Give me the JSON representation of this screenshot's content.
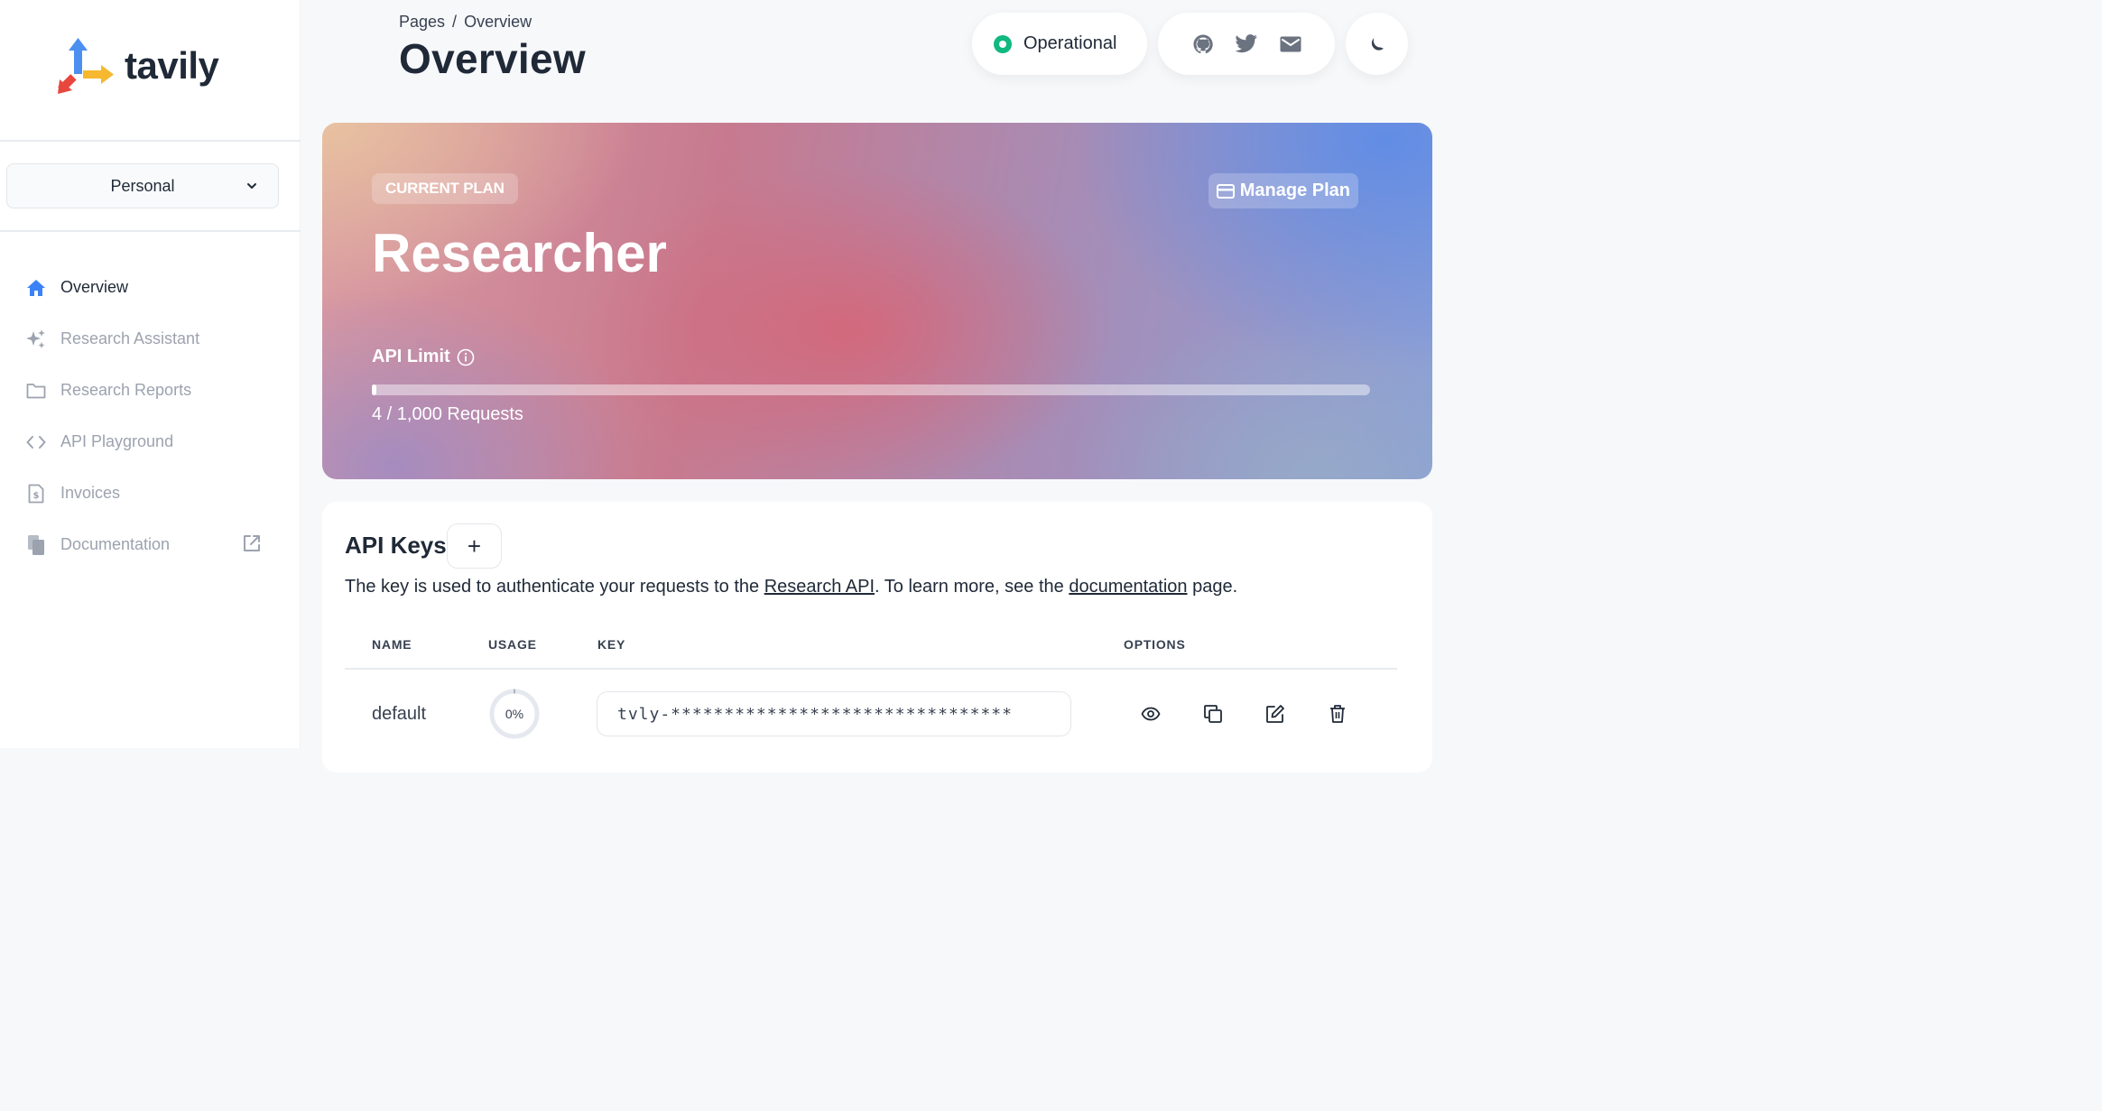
{
  "brand": {
    "name": "tavily"
  },
  "sidebar": {
    "workspace": {
      "selected": "Personal"
    },
    "items": [
      {
        "label": "Overview",
        "icon": "home-icon",
        "active": true
      },
      {
        "label": "Research Assistant",
        "icon": "sparkles-icon",
        "active": false
      },
      {
        "label": "Research Reports",
        "icon": "folder-icon",
        "active": false
      },
      {
        "label": "API Playground",
        "icon": "code-icon",
        "active": false
      },
      {
        "label": "Invoices",
        "icon": "invoice-icon",
        "active": false
      },
      {
        "label": "Documentation",
        "icon": "documents-icon",
        "active": false,
        "external": true
      }
    ]
  },
  "header": {
    "breadcrumb": {
      "parent": "Pages",
      "separator": "/",
      "current": "Overview"
    },
    "title": "Overview",
    "status": {
      "label": "Operational",
      "color": "#10b981"
    },
    "social": [
      "github-icon",
      "twitter-icon",
      "mail-icon"
    ],
    "theme_toggle": "moon-icon"
  },
  "plan": {
    "badge": "CURRENT PLAN",
    "name": "Researcher",
    "manage_label": "Manage Plan",
    "limit_label": "API Limit",
    "used": 4,
    "limit": 1000,
    "usage_text": "4 / 1,000 Requests"
  },
  "api_keys": {
    "title": "API Keys",
    "add_label": "+",
    "description": {
      "prefix": "The key is used to authenticate your requests to the ",
      "link1": "Research API",
      "middle": ". To learn more, see the ",
      "link2": "documentation",
      "suffix": " page."
    },
    "columns": {
      "name": "NAME",
      "usage": "USAGE",
      "key": "KEY",
      "options": "OPTIONS"
    },
    "rows": [
      {
        "name": "default",
        "usage": "0%",
        "usage_fraction": 0,
        "key": "tvly-********************************"
      }
    ]
  },
  "colors": {
    "accent": "#3b82f6",
    "status": "#10b981",
    "text": "#1f2937",
    "muted": "#9ca3af"
  }
}
